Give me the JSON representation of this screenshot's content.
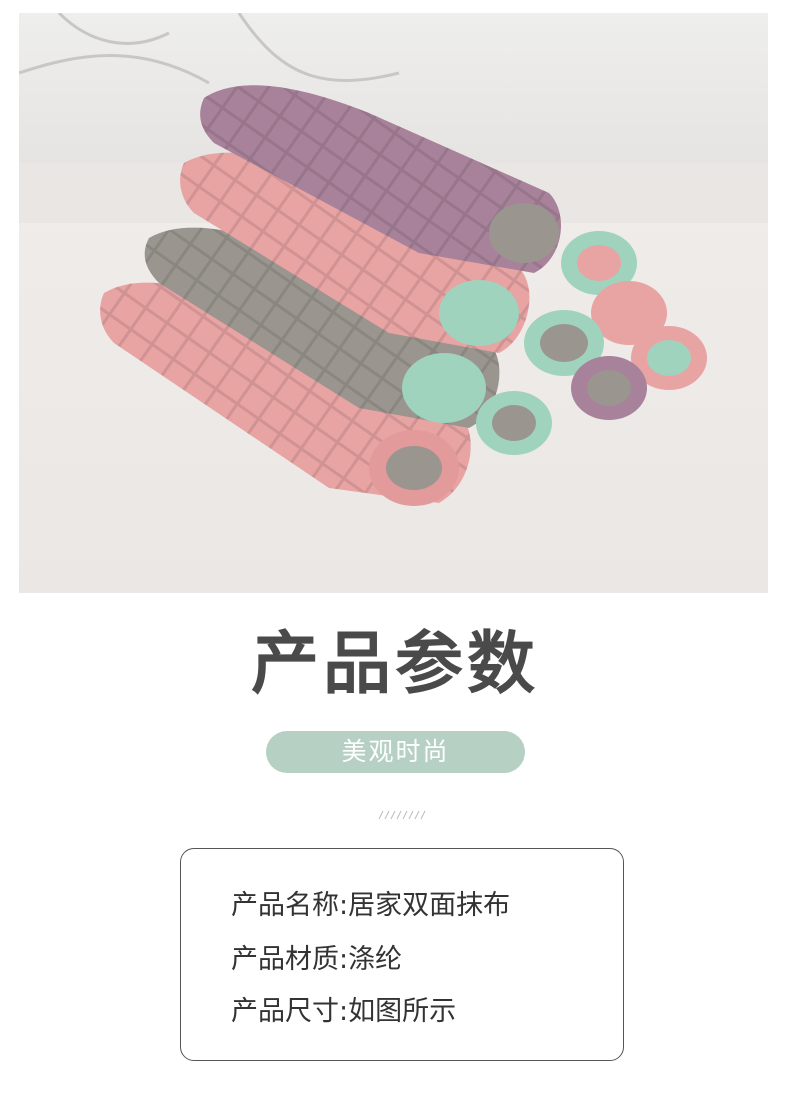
{
  "photo": {
    "subject": "stack of rolled double-sided cleaning cloths in pink, purple, gray and mint"
  },
  "heading": {
    "title": "产品参数",
    "subtitle": "美观时尚"
  },
  "decor": {
    "hatch": "////////"
  },
  "specs": [
    {
      "label": "产品名称:",
      "value": "居家双面抹布"
    },
    {
      "label": "产品材质:",
      "value": "涤纶"
    },
    {
      "label": "产品尺寸:",
      "value": "如图所示"
    }
  ],
  "colors": {
    "pill": "#b7d0c4",
    "title": "#4a4a4a",
    "pink": "#e8a3a3",
    "purple": "#a8829a",
    "gray": "#9a958f",
    "mint": "#9fd3bd"
  }
}
